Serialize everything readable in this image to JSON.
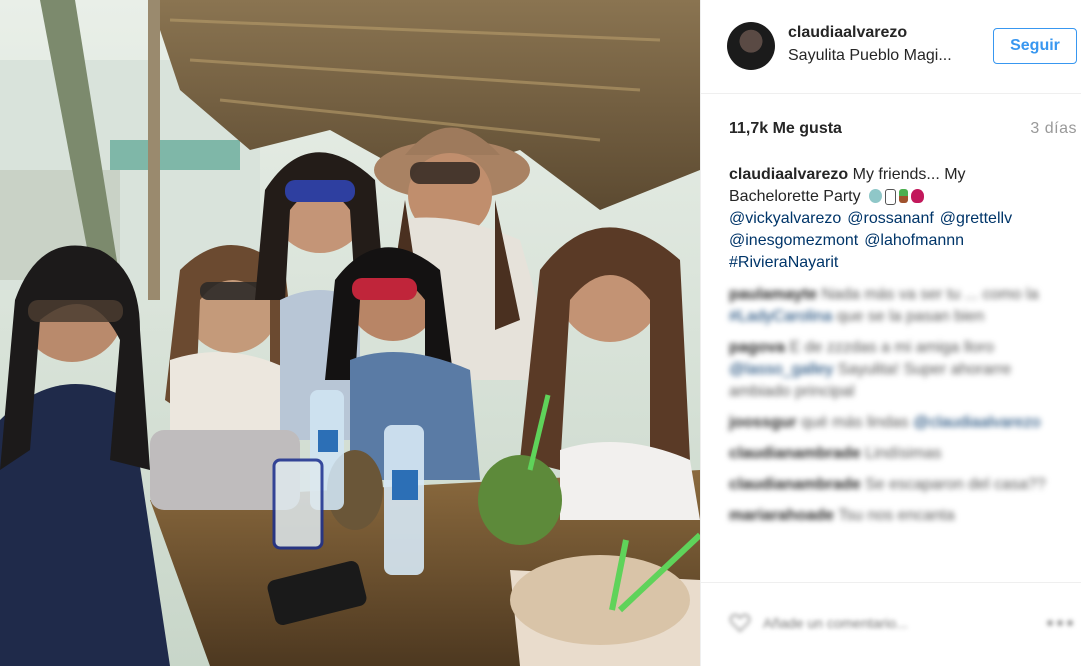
{
  "post": {
    "username": "claudiaalvarezo",
    "location": "Sayulita Pueblo Magi...",
    "follow_label": "Seguir",
    "likes": "11,7k Me gusta",
    "time": "3 días",
    "caption_user": "claudiaalvarezo",
    "caption_text": "My friends... My Bachelorette Party",
    "caption_emojis": [
      "face-with-sunglasses-emoji",
      "smartphone-emoji",
      "palm-tree-emoji",
      "broken-heart-emoji"
    ],
    "mentions_line1": [
      "@vickyalvarezo",
      "@rossananf",
      "@grettellv"
    ],
    "mentions_line2": [
      "@inesgomezmont",
      "@lahofmannn"
    ],
    "hashtag": "#RivieraNayarit"
  },
  "blurred_comments": [
    {
      "user": "paulamayte",
      "text": "Nada más va ser tu ... como la",
      "link": "#LadyCarolina",
      "tail": "que se la pasan bien"
    },
    {
      "user": "pagova",
      "text": "E de   zzzdas a mi amiga lloro",
      "link": "@lasso_galley",
      "tail": "Sayulita! Super ahorarre ambiado principal"
    },
    {
      "user": "joossgur",
      "text": "qué más lindas",
      "link": "@claudiaalvarezo",
      "tail": ""
    },
    {
      "user": "claudianambrade",
      "text": "Lindísimas",
      "link": "",
      "tail": ""
    },
    {
      "user": "claudianambrade",
      "text": "Se escaparon del casa??",
      "link": "",
      "tail": ""
    },
    {
      "user": "mariarahoade",
      "text": "Tsu nos encanta",
      "link": "",
      "tail": ""
    }
  ],
  "comment_box": {
    "placeholder": "Añade un comentario..."
  },
  "colors": {
    "accent": "#3897f0",
    "link": "#003569",
    "text": "#262626",
    "muted": "#999999"
  }
}
